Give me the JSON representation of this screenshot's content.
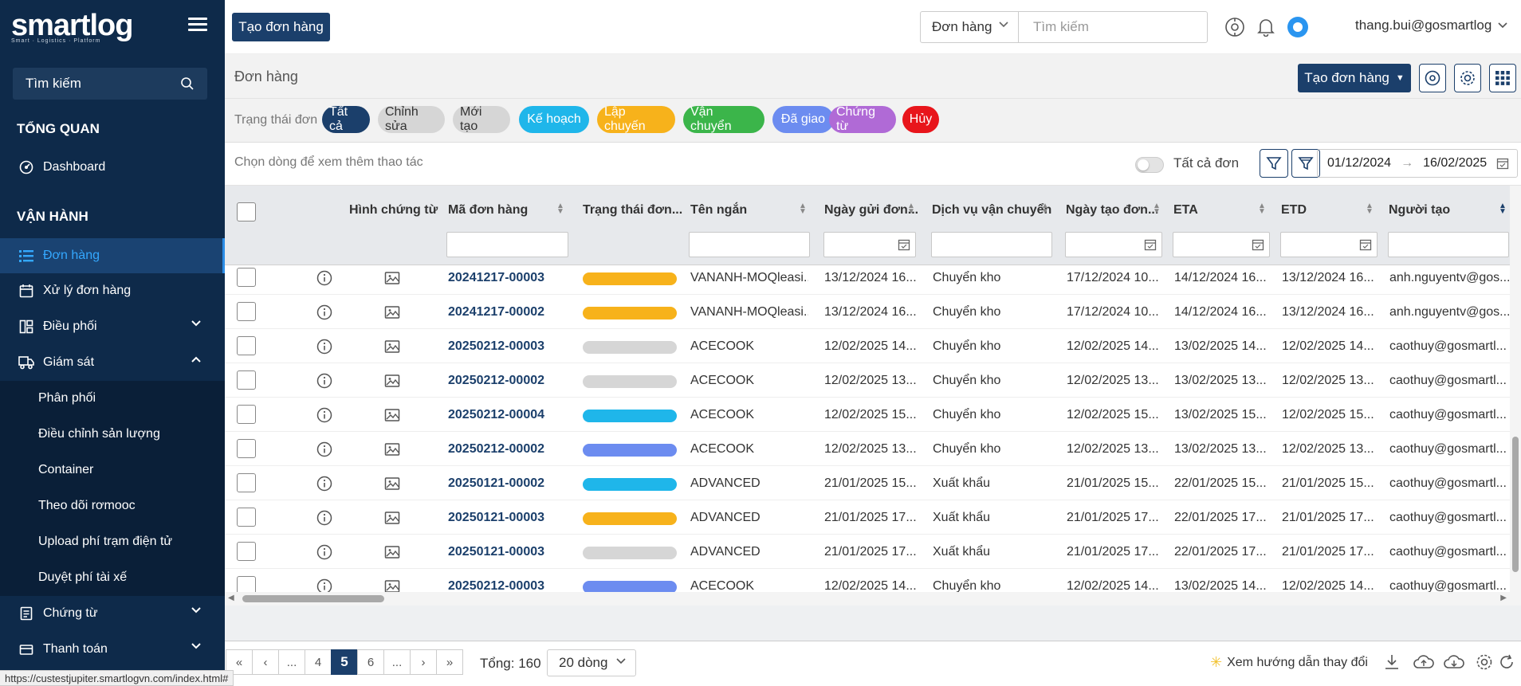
{
  "sidebar": {
    "logo": "smartlog",
    "logo_tagline": "Smart · Logistics · Platform",
    "search_placeholder": "Tìm kiếm",
    "section_overview": "TỔNG QUAN",
    "section_operations": "VẬN HÀNH",
    "items": [
      {
        "label": "Dashboard",
        "icon": "dashboard-icon"
      },
      {
        "label": "Đơn hàng",
        "icon": "list-icon",
        "active": true
      },
      {
        "label": "Xử lý đơn hàng",
        "icon": "calendar-icon"
      },
      {
        "label": "Điều phối",
        "icon": "dispatch-icon",
        "expandable": true
      },
      {
        "label": "Giám sát",
        "icon": "truck-icon",
        "expanded": true
      },
      {
        "label": "Chứng từ",
        "icon": "document-icon",
        "expandable": true
      },
      {
        "label": "Thanh toán",
        "icon": "payment-icon",
        "expandable": true
      }
    ],
    "sub_items": [
      "Phân phối",
      "Điều chỉnh sản lượng",
      "Container",
      "Theo dõi rơmooc",
      "Upload phí trạm điện tử",
      "Duyệt phí tài xế"
    ]
  },
  "topbar": {
    "create_label": "Tạo đơn hàng",
    "scope": "Đơn hàng",
    "search_placeholder": "Tìm kiếm",
    "user": "thang.bui@gosmartlog"
  },
  "page": {
    "title": "Đơn hàng",
    "create_label": "Tạo đơn hàng"
  },
  "status": {
    "label": "Trạng thái đơn",
    "chips": [
      {
        "label": "Tất cả",
        "bg": "#1b3f6b",
        "fg": "#ffffff"
      },
      {
        "label": "Chỉnh sửa",
        "bg": "#d6d6d6",
        "fg": "#333333"
      },
      {
        "label": "Mới tạo",
        "bg": "#d6d6d6",
        "fg": "#333333"
      },
      {
        "label": "Kế hoạch",
        "bg": "#1fb6ea",
        "fg": "#ffffff"
      },
      {
        "label": "Lập chuyến",
        "bg": "#f7b21b",
        "fg": "#ffffff"
      },
      {
        "label": "Vận chuyển",
        "bg": "#3bb54a",
        "fg": "#ffffff"
      },
      {
        "label": "Đã giao",
        "bg": "#6c8cf0",
        "fg": "#ffffff"
      },
      {
        "label": "Chứng từ",
        "bg": "#b06ad6",
        "fg": "#ffffff"
      },
      {
        "label": "Hủy",
        "bg": "#e8151b",
        "fg": "#ffffff"
      }
    ]
  },
  "toolbar": {
    "hint": "Chọn dòng để xem thêm thao tác",
    "toggle_label": "Tất cả đơn",
    "date_from": "01/12/2024",
    "date_to": "16/02/2025"
  },
  "columns": {
    "doc_image": "Hình chứng từ",
    "order_code": "Mã đơn hàng",
    "status": "Trạng thái đơn...",
    "short_name": "Tên ngắn",
    "sent_date": "Ngày gửi đơn...",
    "service": "Dịch vụ vận chuyển",
    "created_date": "Ngày tạo đơn...",
    "eta": "ETA",
    "etd": "ETD",
    "creator": "Người tạo"
  },
  "rows": [
    {
      "code": "20241217-00003",
      "status_color": "#f7b21b",
      "name": "VANANH-MOQleasi...",
      "sent": "13/12/2024 16...",
      "service": "Chuyển kho",
      "created": "17/12/2024 10...",
      "eta": "14/12/2024 16...",
      "etd": "13/12/2024 16...",
      "creator": "anh.nguyentv@gos..."
    },
    {
      "code": "20241217-00002",
      "status_color": "#f7b21b",
      "name": "VANANH-MOQleasi...",
      "sent": "13/12/2024 16...",
      "service": "Chuyển kho",
      "created": "17/12/2024 10...",
      "eta": "14/12/2024 16...",
      "etd": "13/12/2024 16...",
      "creator": "anh.nguyentv@gos..."
    },
    {
      "code": "20250212-00003",
      "status_color": "#d6d6d6",
      "name": "ACECOOK",
      "sent": "12/02/2025 14...",
      "service": "Chuyển kho",
      "created": "12/02/2025 14...",
      "eta": "13/02/2025 14...",
      "etd": "12/02/2025 14...",
      "creator": "caothuy@gosmartl..."
    },
    {
      "code": "20250212-00002",
      "status_color": "#d6d6d6",
      "name": "ACECOOK",
      "sent": "12/02/2025 13...",
      "service": "Chuyển kho",
      "created": "12/02/2025 13...",
      "eta": "13/02/2025 13...",
      "etd": "12/02/2025 13...",
      "creator": "caothuy@gosmartl..."
    },
    {
      "code": "20250212-00004",
      "status_color": "#1fb6ea",
      "name": "ACECOOK",
      "sent": "12/02/2025 15...",
      "service": "Chuyển kho",
      "created": "12/02/2025 15...",
      "eta": "13/02/2025 15...",
      "etd": "12/02/2025 15...",
      "creator": "caothuy@gosmartl..."
    },
    {
      "code": "20250212-00002",
      "status_color": "#6c8cf0",
      "name": "ACECOOK",
      "sent": "12/02/2025 13...",
      "service": "Chuyển kho",
      "created": "12/02/2025 13...",
      "eta": "13/02/2025 13...",
      "etd": "12/02/2025 13...",
      "creator": "caothuy@gosmartl..."
    },
    {
      "code": "20250121-00002",
      "status_color": "#1fb6ea",
      "name": "ADVANCED",
      "sent": "21/01/2025 15...",
      "service": "Xuất khẩu",
      "created": "21/01/2025 15...",
      "eta": "22/01/2025 15...",
      "etd": "21/01/2025 15...",
      "creator": "caothuy@gosmartl..."
    },
    {
      "code": "20250121-00003",
      "status_color": "#f7b21b",
      "name": "ADVANCED",
      "sent": "21/01/2025 17...",
      "service": "Xuất khẩu",
      "created": "21/01/2025 17...",
      "eta": "22/01/2025 17...",
      "etd": "21/01/2025 17...",
      "creator": "caothuy@gosmartl..."
    },
    {
      "code": "20250121-00003",
      "status_color": "#d6d6d6",
      "name": "ADVANCED",
      "sent": "21/01/2025 17...",
      "service": "Xuất khẩu",
      "created": "21/01/2025 17...",
      "eta": "22/01/2025 17...",
      "etd": "21/01/2025 17...",
      "creator": "caothuy@gosmartl..."
    },
    {
      "code": "20250212-00003",
      "status_color": "#6c8cf0",
      "name": "ACECOOK",
      "sent": "12/02/2025 14...",
      "service": "Chuyển kho",
      "created": "12/02/2025 14...",
      "eta": "13/02/2025 14...",
      "etd": "12/02/2025 14...",
      "creator": "caothuy@gosmartl..."
    }
  ],
  "pagination": {
    "pages": [
      "...",
      "4",
      "5",
      "6",
      "..."
    ],
    "current": "5",
    "total_label": "Tổng: 160",
    "page_size": "20 dòng"
  },
  "footer": {
    "guide_label": "Xem hướng dẫn thay đổi"
  },
  "status_url": "https://custestjupiter.smartlogvn.com/index.html#"
}
